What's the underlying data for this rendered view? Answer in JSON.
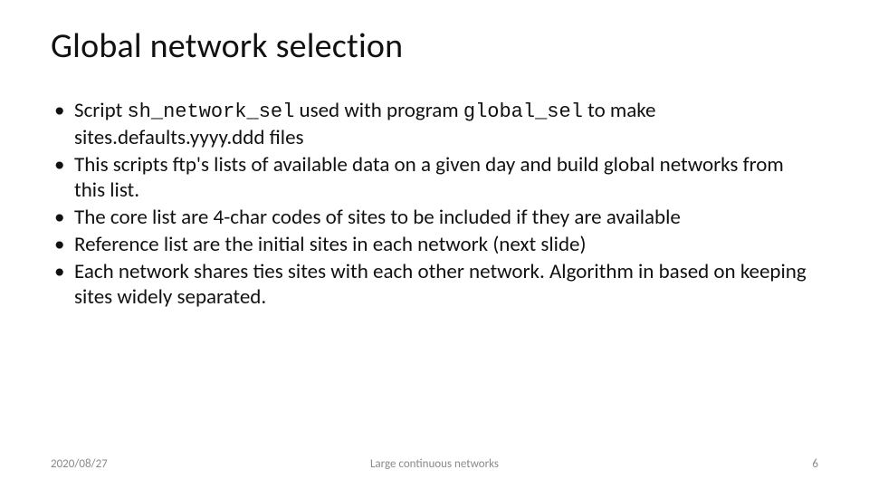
{
  "title": "Global network selection",
  "bullets": {
    "b0_pre": "Script ",
    "b0_code1": "sh_network_sel",
    "b0_mid": " used with program ",
    "b0_code2": "global_sel",
    "b0_post": " to make sites.defaults.yyyy.ddd files",
    "b1": "This scripts ftp's lists of available data on a given day and build global networks from this list.",
    "b2": "The core list are 4-char codes of sites to be included if they are available",
    "b3": "Reference list are the initial sites in each network (next slide)",
    "b4": "Each network shares ties sites with each other network.  Algorithm in based on keeping sites widely separated."
  },
  "footer": {
    "date": "2020/08/27",
    "center": "Large continuous networks",
    "page": "6"
  }
}
